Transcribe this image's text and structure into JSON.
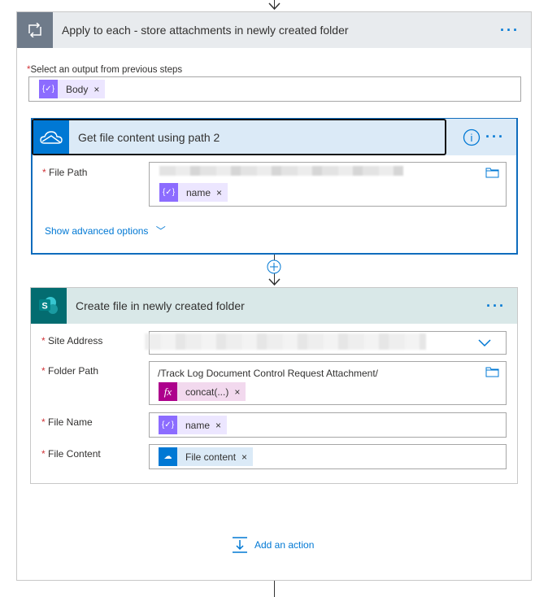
{
  "loop": {
    "title": "Apply to each - store attachments in newly created folder",
    "select_label": "Select an output from previous steps",
    "token": "Body",
    "more": "···"
  },
  "card1": {
    "title": "Get file content using path 2",
    "file_path_label": "File Path",
    "token": "name",
    "advanced": "Show advanced options",
    "more": "···"
  },
  "card2": {
    "title": "Create file in newly created folder",
    "more": "···",
    "site_label": "Site Address",
    "folder_label": "Folder Path",
    "folder_value": "/Track Log  Document Control Request Attachment/",
    "folder_token": "concat(...)",
    "file_name_label": "File Name",
    "file_name_token": "name",
    "file_content_label": "File Content",
    "file_content_token": "File content"
  },
  "add_action": "Add an action",
  "colors": {
    "accent": "#0078d4",
    "variable": "#8c6cff",
    "expression": "#ad008c",
    "sharepoint": "#036c70"
  }
}
